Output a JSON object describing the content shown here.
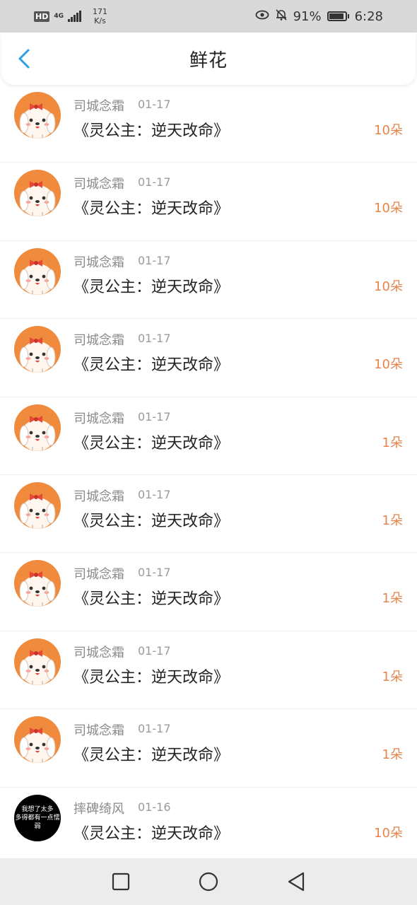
{
  "status_bar": {
    "hd": "HD",
    "network": "4G",
    "speed_value": "171",
    "speed_unit": "K/s",
    "battery_pct": "91%",
    "battery_level": 0.91,
    "time": "6:28",
    "icons": [
      "eye-icon",
      "bell-off-icon",
      "battery-icon"
    ]
  },
  "header": {
    "title": "鲜花",
    "back_icon": "chevron-left-icon"
  },
  "colors": {
    "accent": "#2b9fe6",
    "count": "#e8844a",
    "avatar_bg": "#f08a3c"
  },
  "records": [
    {
      "name": "司城念霜",
      "date": "01-17",
      "book": "《灵公主：逆天改命》",
      "count": "10朵",
      "avatar": "cartoon-dog"
    },
    {
      "name": "司城念霜",
      "date": "01-17",
      "book": "《灵公主：逆天改命》",
      "count": "10朵",
      "avatar": "cartoon-dog"
    },
    {
      "name": "司城念霜",
      "date": "01-17",
      "book": "《灵公主：逆天改命》",
      "count": "10朵",
      "avatar": "cartoon-dog"
    },
    {
      "name": "司城念霜",
      "date": "01-17",
      "book": "《灵公主：逆天改命》",
      "count": "10朵",
      "avatar": "cartoon-dog"
    },
    {
      "name": "司城念霜",
      "date": "01-17",
      "book": "《灵公主：逆天改命》",
      "count": "1朵",
      "avatar": "cartoon-dog"
    },
    {
      "name": "司城念霜",
      "date": "01-17",
      "book": "《灵公主：逆天改命》",
      "count": "1朵",
      "avatar": "cartoon-dog"
    },
    {
      "name": "司城念霜",
      "date": "01-17",
      "book": "《灵公主：逆天改命》",
      "count": "1朵",
      "avatar": "cartoon-dog"
    },
    {
      "name": "司城念霜",
      "date": "01-17",
      "book": "《灵公主：逆天改命》",
      "count": "1朵",
      "avatar": "cartoon-dog"
    },
    {
      "name": "司城念霜",
      "date": "01-17",
      "book": "《灵公主：逆天改命》",
      "count": "1朵",
      "avatar": "cartoon-dog"
    },
    {
      "name": "摔碑绮风",
      "date": "01-16",
      "book": "《灵公主：逆天改命》",
      "count": "10朵",
      "avatar": "text-avatar",
      "avatar_text": [
        "我想了太多",
        "多得都有一点懦弱"
      ]
    }
  ],
  "nav_bar": {
    "buttons": [
      "recents-square-icon",
      "home-circle-icon",
      "back-triangle-icon"
    ]
  }
}
